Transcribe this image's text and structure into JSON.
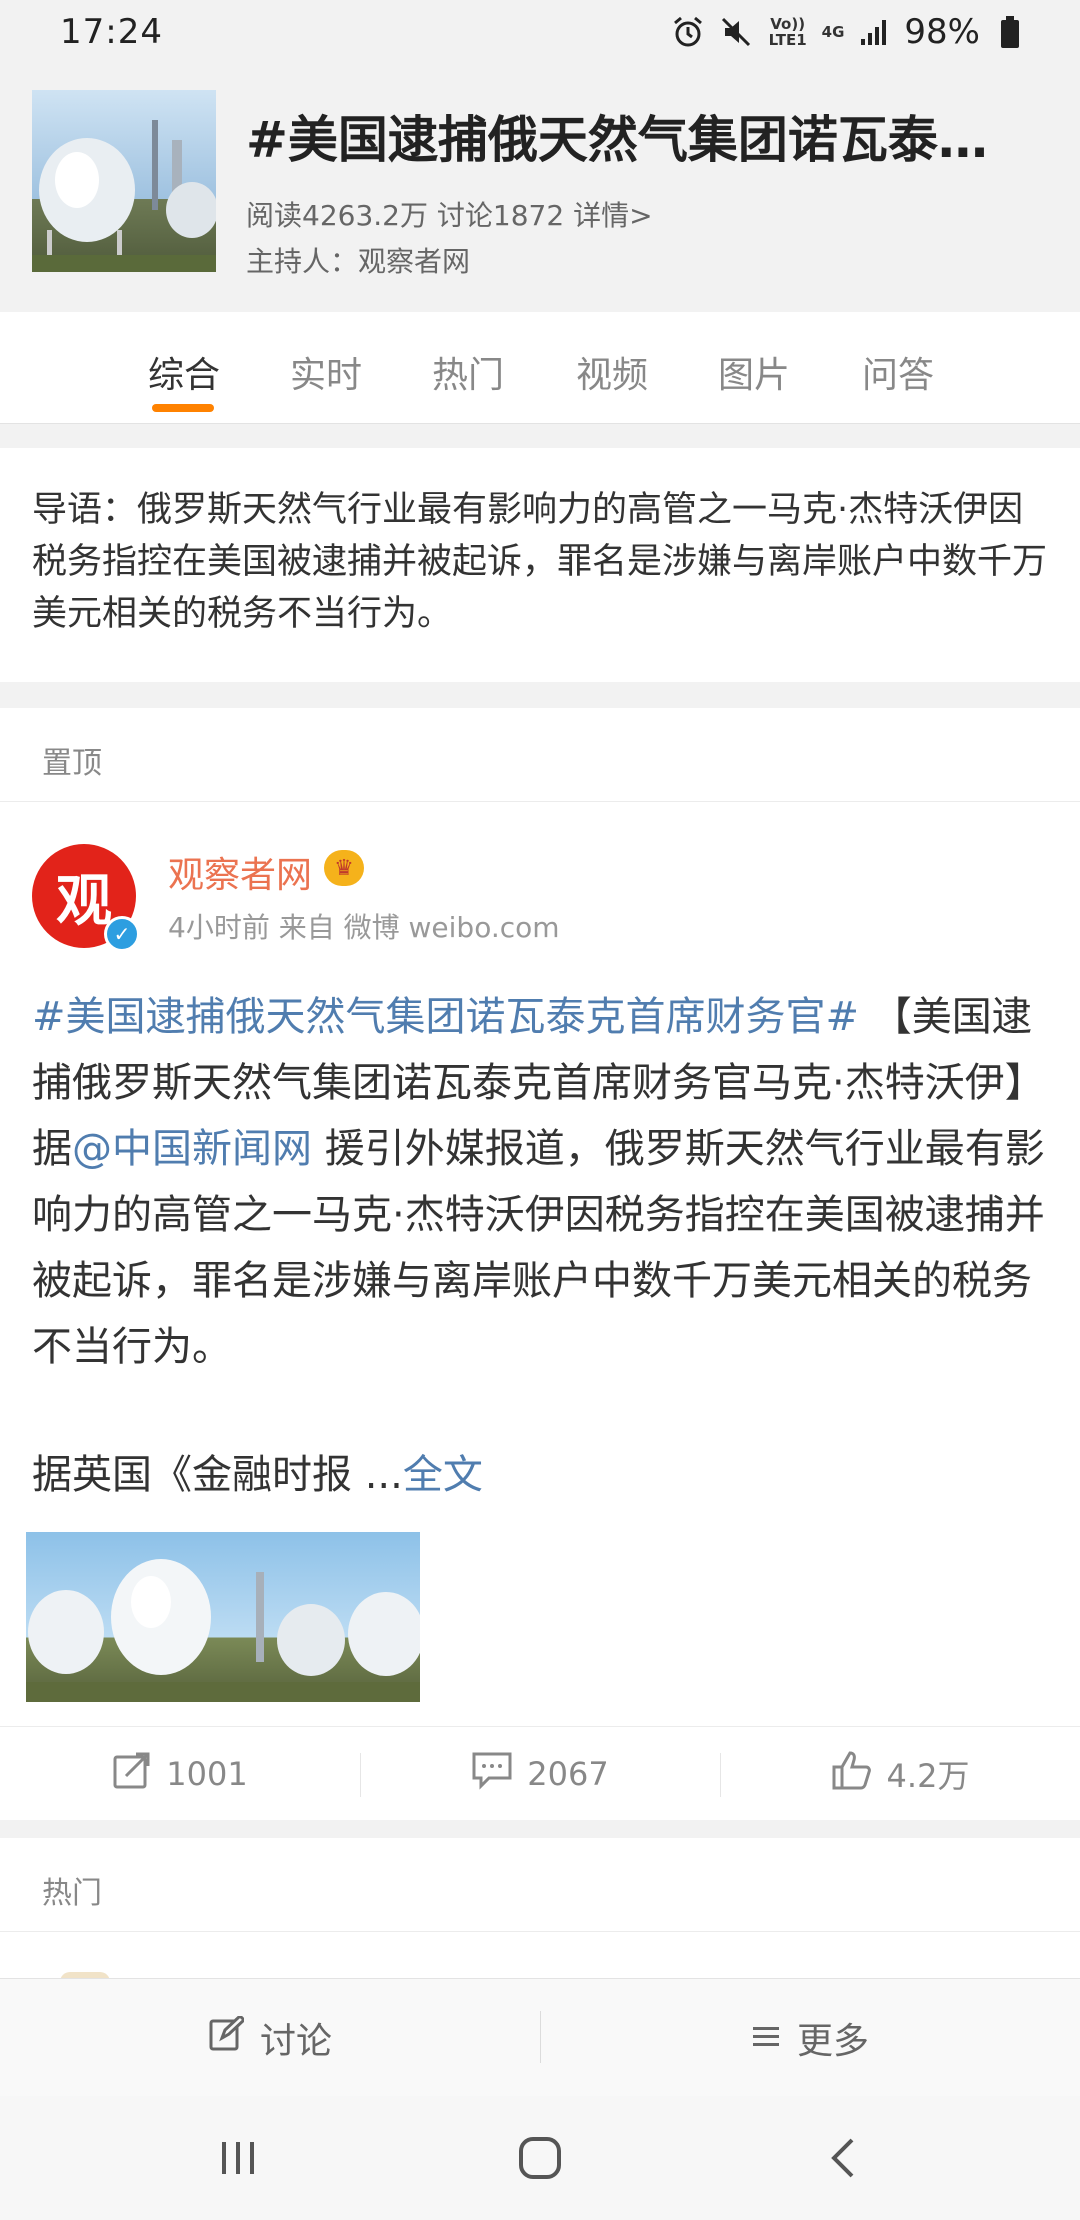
{
  "status_bar": {
    "time": "17:24",
    "network_label": "Vo)) LTE1",
    "network_type": "4G",
    "battery": "98%"
  },
  "topic": {
    "title": "#美国逮捕俄天然气集团诺瓦泰…",
    "stats_reads": "阅读4263.2万",
    "stats_discuss": "讨论1872",
    "details_link": "详情>",
    "host": "主持人：观察者网"
  },
  "tabs": [
    {
      "label": "综合",
      "active": true
    },
    {
      "label": "实时"
    },
    {
      "label": "热门"
    },
    {
      "label": "视频"
    },
    {
      "label": "图片"
    },
    {
      "label": "问答"
    }
  ],
  "lead_text": "导语：俄罗斯天然气行业最有影响力的高管之一马克·杰特沃伊因税务指控在美国被逮捕并被起诉，罪名是涉嫌与离岸账户中数千万美元相关的税务不当行为。",
  "sections": {
    "pinned": "置顶",
    "hot": "热门"
  },
  "post": {
    "avatar_text": "观",
    "author": "观察者网",
    "meta": "4小时前 来自 微博 weibo.com",
    "hashtag": "#美国逮捕俄天然气集团诺瓦泰克首席财务官#",
    "body_part1": " 【美国逮捕俄罗斯天然气集团诺瓦泰克首席财务官马克·杰特沃伊】据",
    "mention": "@中国新闻网",
    "body_part2": " 援引外媒报道，俄罗斯天然气行业最有影响力的高管之一马克·杰特沃伊因税务指控在美国被逮捕并被起诉，罪名是涉嫌与离岸账户中数千万美元相关的税务不当行为。",
    "more_prefix": "据英国《金融时报 ...",
    "more_link": "全文",
    "reposts": "1001",
    "comments": "2067",
    "likes": "4.2万"
  },
  "bottom_bar": {
    "discuss": "讨论",
    "more": "更多"
  },
  "colors": {
    "accent_orange": "#ff8200",
    "link_blue": "#507daf",
    "author_orange": "#eb7350"
  }
}
